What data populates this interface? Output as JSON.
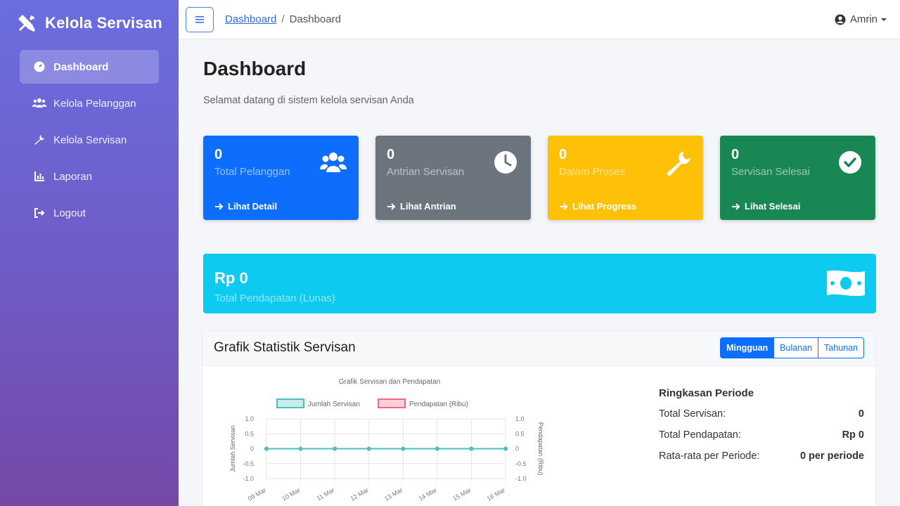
{
  "app": {
    "brand": "Kelola Servisan"
  },
  "sidebar": {
    "items": [
      {
        "label": "Dashboard",
        "icon": "dashboard-icon",
        "active": true
      },
      {
        "label": "Kelola Pelanggan",
        "icon": "users-icon"
      },
      {
        "label": "Kelola Servisan",
        "icon": "wrench-icon"
      },
      {
        "label": "Laporan",
        "icon": "chart-icon"
      },
      {
        "label": "Logout",
        "icon": "logout-icon"
      }
    ]
  },
  "topbar": {
    "breadcrumb": [
      "Dashboard",
      "Dashboard"
    ],
    "user": "Amrin"
  },
  "page": {
    "title": "Dashboard",
    "subtitle": "Selamat datang di sistem kelola servisan Anda"
  },
  "stats": [
    {
      "value": "0",
      "label": "Total Pelanggan",
      "link": "Lihat Detail",
      "icon": "users-icon",
      "color": "#0d6efd"
    },
    {
      "value": "0",
      "label": "Antrian Servisan",
      "link": "Lihat Antrian",
      "icon": "clock-icon",
      "color": "#6c757d"
    },
    {
      "value": "0",
      "label": "Dalam Proses",
      "link": "Lihat Progress",
      "icon": "wrench-icon",
      "color": "#ffc107"
    },
    {
      "value": "0",
      "label": "Servisan Selesai",
      "link": "Lihat Selesai",
      "icon": "check-circle-icon",
      "color": "#198754"
    }
  ],
  "revenue": {
    "value": "Rp 0",
    "label": "Total Pendapatan (Lunas)",
    "icon": "money-icon",
    "color": "#0dcaf0"
  },
  "chart_card": {
    "title": "Grafik Statistik Servisan",
    "periods": [
      "Mingguan",
      "Bulanan",
      "Tahunan"
    ],
    "active_period": "Mingguan"
  },
  "chart_data": {
    "type": "line",
    "title": "Grafik Servisan dan Pendapatan",
    "x": [
      "09 Mar",
      "10 Mar",
      "11 Mar",
      "12 Mar",
      "13 Mar",
      "14 Mar",
      "15 Mar",
      "16 Mar"
    ],
    "series": [
      {
        "name": "Jumlah Servisan",
        "values": [
          0,
          0,
          0,
          0,
          0,
          0,
          0,
          0
        ],
        "color": "#4bc0c0"
      },
      {
        "name": "Pendapatan (Ribu)",
        "values": [
          0,
          0,
          0,
          0,
          0,
          0,
          0,
          0
        ],
        "color": "#ff6384"
      }
    ],
    "ylabel": "Jumlah Servisan",
    "y2label": "Pendapatan (Ribu)",
    "ylim": [
      -1,
      1
    ],
    "yticks": [
      "1.0",
      "0.5",
      "0",
      "-0.5",
      "-1.0"
    ],
    "grid": true,
    "legend": "top"
  },
  "summary": {
    "title": "Ringkasan Periode",
    "rows": [
      {
        "label": "Total Servisan:",
        "value": "0"
      },
      {
        "label": "Total Pendapatan:",
        "value": "Rp 0"
      },
      {
        "label": "Rata-rata per Periode:",
        "value": "0 per periode"
      }
    ]
  }
}
